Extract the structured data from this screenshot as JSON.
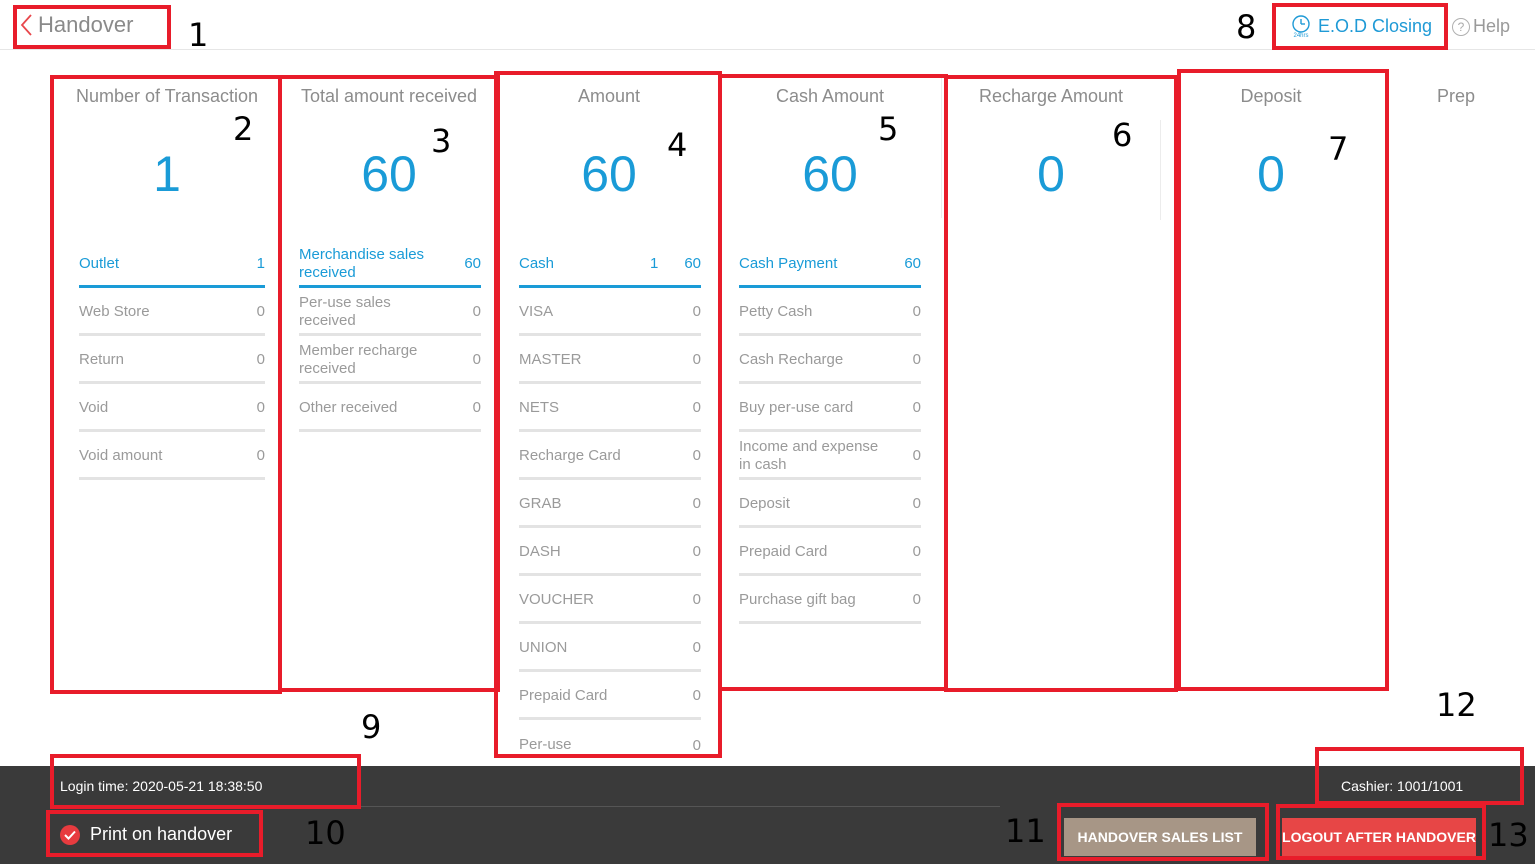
{
  "header": {
    "title": "Handover",
    "eod_label": "E.O.D Closing",
    "eod_icon_text": "24hrs",
    "help_label": "Help"
  },
  "columns": [
    {
      "title": "Number of Transaction",
      "value": "1",
      "rows": [
        {
          "label": "Outlet",
          "values": [
            "1"
          ],
          "active": true
        },
        {
          "label": "Web Store",
          "values": [
            "0"
          ]
        },
        {
          "label": "Return",
          "values": [
            "0"
          ]
        },
        {
          "label": "Void",
          "values": [
            "0"
          ]
        },
        {
          "label": "Void amount",
          "values": [
            "0"
          ]
        }
      ]
    },
    {
      "title": "Total amount received",
      "value": "60",
      "rows": [
        {
          "label": "Merchandise sales received",
          "values": [
            "60"
          ],
          "active": true
        },
        {
          "label": "Per-use sales received",
          "values": [
            "0"
          ]
        },
        {
          "label": "Member recharge received",
          "values": [
            "0"
          ]
        },
        {
          "label": "Other received",
          "values": [
            "0"
          ]
        }
      ]
    },
    {
      "title": "Amount",
      "value": "60",
      "rows": [
        {
          "label": "Cash",
          "values": [
            "1",
            "60"
          ],
          "active": true
        },
        {
          "label": "VISA",
          "values": [
            "0"
          ]
        },
        {
          "label": "MASTER",
          "values": [
            "0"
          ]
        },
        {
          "label": "NETS",
          "values": [
            "0"
          ]
        },
        {
          "label": "Recharge Card",
          "values": [
            "0"
          ]
        },
        {
          "label": "GRAB",
          "values": [
            "0"
          ]
        },
        {
          "label": "DASH",
          "values": [
            "0"
          ]
        },
        {
          "label": "VOUCHER",
          "values": [
            "0"
          ]
        },
        {
          "label": "UNION",
          "values": [
            "0"
          ]
        },
        {
          "label": "Prepaid Card",
          "values": [
            "0"
          ]
        },
        {
          "label": "Per-use",
          "values": [
            "0"
          ]
        }
      ]
    },
    {
      "title": "Cash Amount",
      "value": "60",
      "rows": [
        {
          "label": "Cash Payment",
          "values": [
            "60"
          ],
          "active": true
        },
        {
          "label": "Petty Cash",
          "values": [
            "0"
          ]
        },
        {
          "label": "Cash Recharge",
          "values": [
            "0"
          ]
        },
        {
          "label": "Buy per-use card",
          "values": [
            "0"
          ]
        },
        {
          "label": "Income and expense in cash",
          "values": [
            "0"
          ]
        },
        {
          "label": "Deposit",
          "values": [
            "0"
          ]
        },
        {
          "label": "Prepaid Card",
          "values": [
            "0"
          ]
        },
        {
          "label": "Purchase gift bag",
          "values": [
            "0"
          ]
        }
      ]
    },
    {
      "title": "Recharge Amount",
      "value": "0",
      "rows": []
    },
    {
      "title": "Deposit",
      "value": "0",
      "rows": []
    },
    {
      "title": "Prep",
      "value": "",
      "rows": []
    }
  ],
  "footer": {
    "login_time": "Login time: 2020-05-21 18:38:50",
    "cashier": "Cashier: 1001/1001",
    "print_label": "Print on handover",
    "print_checked": true,
    "sales_list_button": "HANDOVER SALES LIST",
    "logout_button": "LOGOUT AFTER HANDOVER"
  },
  "annotations": [
    "1",
    "2",
    "3",
    "4",
    "5",
    "6",
    "7",
    "8",
    "9",
    "10",
    "11",
    "12",
    "13"
  ],
  "colors": {
    "accent": "#1a9bd7",
    "annotation": "#e81c2a",
    "footer_bg": "#3a3a3a",
    "sales_btn": "#a79686",
    "logout_btn": "#e74646"
  }
}
